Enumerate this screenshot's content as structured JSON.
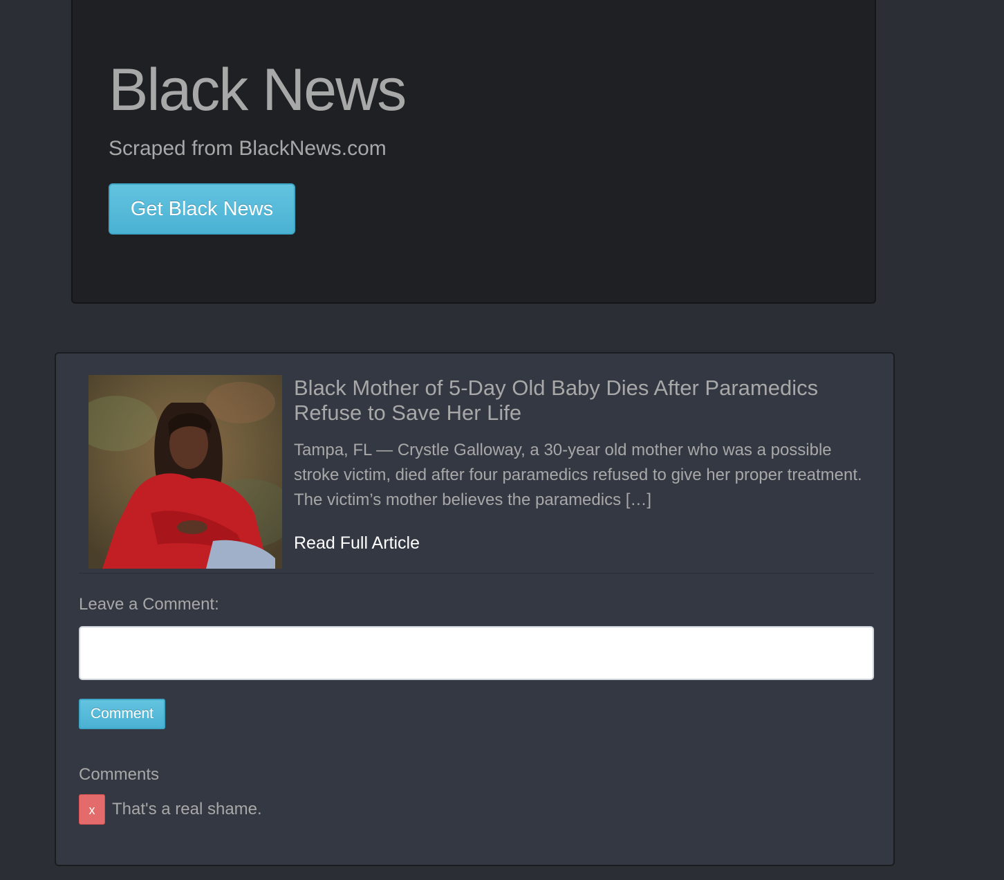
{
  "header": {
    "title": "Black News",
    "subtitle": "Scraped from BlackNews.com",
    "get_news_label": "Get Black News"
  },
  "article": {
    "title": "Black Mother of 5-Day Old Baby Dies After Paramedics Refuse to Save Her Life",
    "excerpt": "Tampa, FL — Crystle Galloway, a 30-year old mother who was a possible stroke victim, died after four paramedics refused to give her proper treatment. The victim’s mother believes the paramedics […]",
    "read_more_label": "Read Full Article"
  },
  "comment_form": {
    "label": "Leave a Comment:",
    "input_value": "",
    "input_placeholder": "",
    "submit_label": "Comment"
  },
  "comments": {
    "heading": "Comments",
    "items": [
      {
        "delete_label": "x",
        "text": "That's a real shame."
      }
    ]
  },
  "colors": {
    "page_background": "#2b2e34",
    "jumbotron_background": "#1f2024",
    "panel_background": "#333842",
    "info_button": "#5bc0de",
    "danger_button": "#e36b6b",
    "muted_text": "#a8a8a8"
  }
}
